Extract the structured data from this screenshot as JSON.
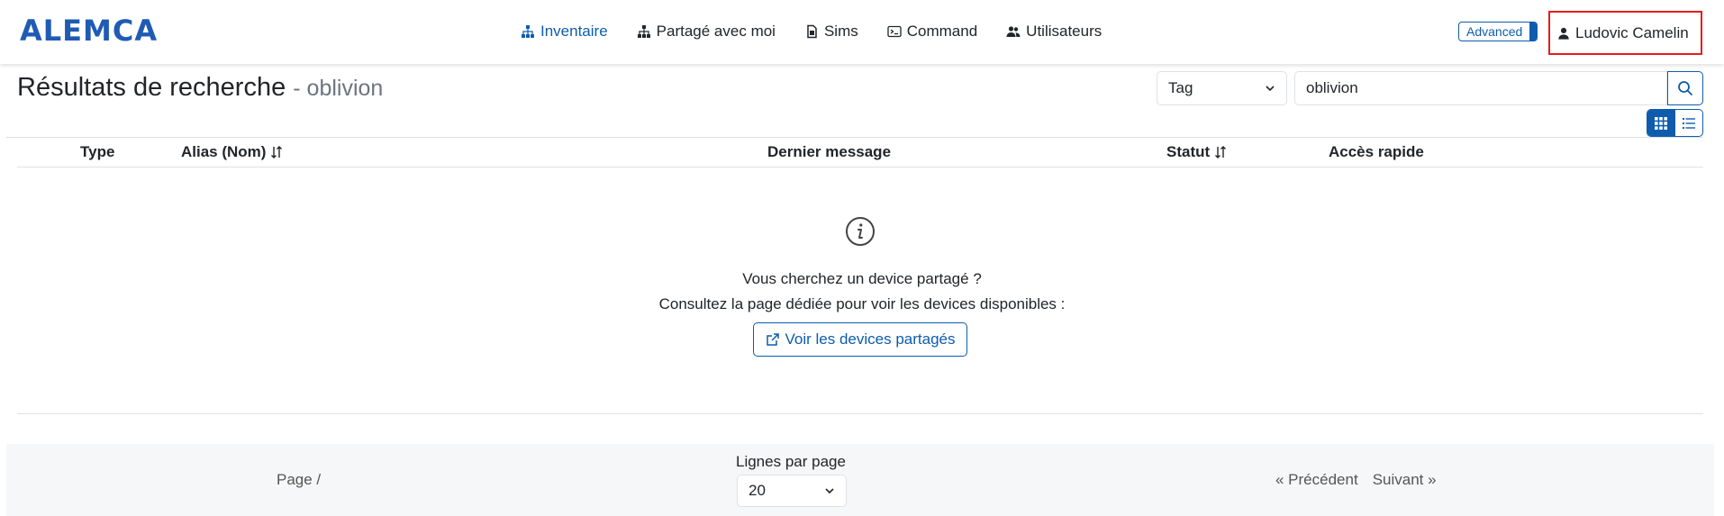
{
  "brand": "ALEMCA",
  "nav": {
    "items": [
      {
        "label": "Inventaire",
        "icon": "sitemap-icon"
      },
      {
        "label": "Partagé avec moi",
        "icon": "sitemap-icon"
      },
      {
        "label": "Sims",
        "icon": "sim-card-icon"
      },
      {
        "label": "Command",
        "icon": "terminal-icon"
      },
      {
        "label": "Utilisateurs",
        "icon": "users-icon"
      }
    ],
    "advanced_label": "Advanced",
    "user_name": "Ludovic Camelin",
    "accent_color": "#0d5cae",
    "highlight_color": "#e31d1d"
  },
  "header": {
    "title": "Résultats de recherche",
    "query_suffix": "- oblivion"
  },
  "search": {
    "type_selected": "Tag",
    "value": "oblivion"
  },
  "table": {
    "columns": [
      "Type",
      "Alias (Nom)",
      "Dernier message",
      "Statut",
      "Accès rapide"
    ]
  },
  "empty_state": {
    "line1": "Vous cherchez un device partagé ?",
    "line2": "Consultez la page dédiée pour voir les devices disponibles :",
    "button_label": "Voir les devices partagés"
  },
  "footer": {
    "page_info": "Page /",
    "rows_label": "Lignes par page",
    "rows_value": "20",
    "prev_label": "« Précédent",
    "next_label": "Suivant »"
  }
}
